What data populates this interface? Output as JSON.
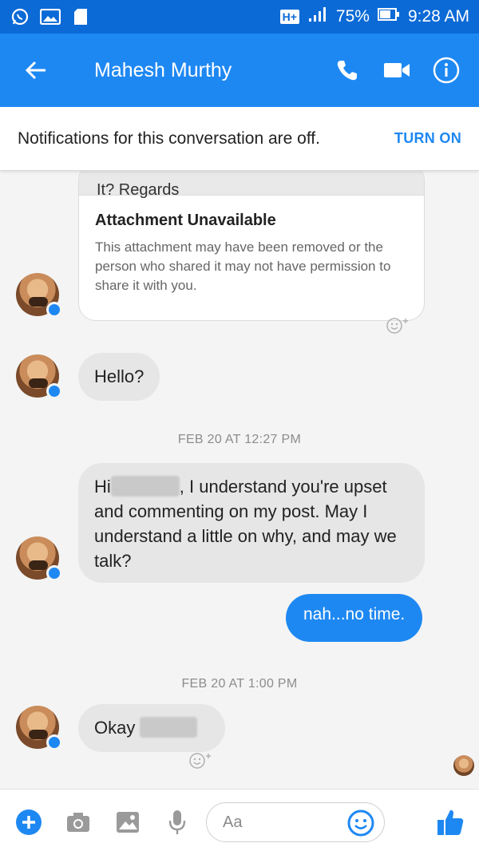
{
  "status_bar": {
    "network_type": "H+",
    "battery": "75%",
    "time": "9:28 AM",
    "left_icons": [
      "whatsapp-icon",
      "image-notification-icon",
      "sd-card-icon"
    ]
  },
  "app_bar": {
    "contact_name": "Mahesh Murthy",
    "icons": [
      "back-arrow-icon",
      "phone-icon",
      "video-camera-icon",
      "info-icon"
    ]
  },
  "notice": {
    "text": "Notifications for this conversation are off.",
    "button_label": "TURN ON"
  },
  "conversation": {
    "attachment": {
      "cut_text": "It? Regards",
      "title": "Attachment Unavailable",
      "body": "This attachment may have been removed or the person who shared it may not have permission to share it with you."
    },
    "message_hello": "Hello?",
    "timestamp_1": "FEB 20 AT 12:27 PM",
    "message_long_prefix": "Hi",
    "message_long_rest": ", I understand you're upset and commenting on my post. May I understand a little on why, and may we talk?",
    "message_out": "nah...no time.",
    "timestamp_2": "FEB 20 AT 1:00 PM",
    "message_okay": "Okay"
  },
  "composer": {
    "placeholder": "Aa",
    "icons": [
      "plus-icon",
      "camera-icon",
      "gallery-icon",
      "microphone-icon",
      "emoji-icon",
      "thumbs-up-icon"
    ]
  },
  "colors": {
    "status_bar": "#0b6ad6",
    "app_bar": "#1e88f2",
    "accent": "#1e88f2",
    "incoming_bubble": "#e6e6e6",
    "conversation_bg": "#f4f4f4"
  }
}
